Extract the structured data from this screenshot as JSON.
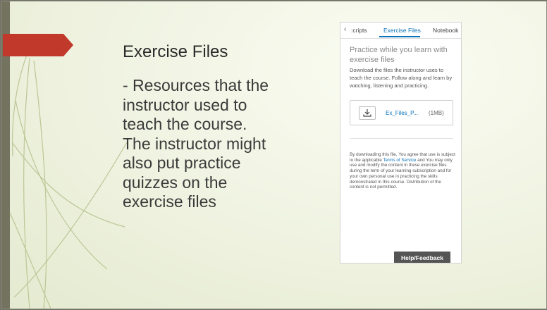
{
  "slide": {
    "title": "Exercise Files",
    "body": "- Resources that the instructor used to teach the course. The instructor might also put practice quizzes on the exercise files"
  },
  "panel": {
    "tabs": {
      "back_icon": "chevron-left-icon",
      "transcripts": ":cripts",
      "exercise_files": "Exercise Files",
      "notebook": "Notebook"
    },
    "heading": "Practice while you learn with exercise files",
    "description": "Download the files the instructor uses to teach the course. Follow along and learn by watching, listening and practicing.",
    "file": {
      "icon": "download-icon",
      "name": "Ex_Files_P...",
      "size": "(1MB)"
    },
    "legal": {
      "part1": "By downloading this file, You agree that use is subject to the applicable ",
      "link": "Terms of Service",
      "part2": " and You may only use and modify the content in these exercise files during the term of your learning subscription and for your own personal use in practicing the skills demonstrated in this course. Distribution of the content is not permitted."
    },
    "help_button": "Help/Feedback"
  },
  "colors": {
    "accent": "#0a72b8",
    "ribbon": "#c0392b",
    "help_button": "#555555"
  }
}
